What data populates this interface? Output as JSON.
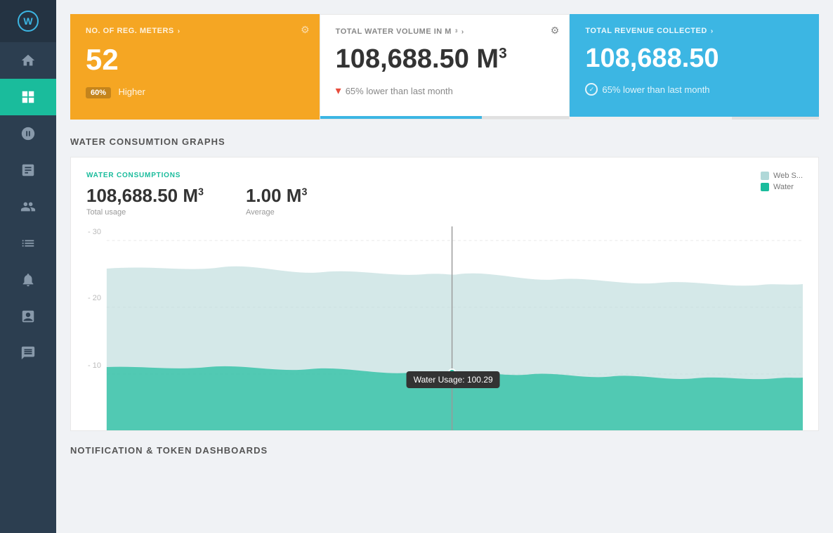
{
  "sidebar": {
    "items": [
      {
        "name": "home",
        "icon": "⌂",
        "active": true
      },
      {
        "name": "users",
        "icon": "👥",
        "active": false
      },
      {
        "name": "charts",
        "icon": "📊",
        "active": false
      },
      {
        "name": "settings",
        "icon": "⚙",
        "active": false
      },
      {
        "name": "groups",
        "icon": "👫",
        "active": false
      },
      {
        "name": "tools",
        "icon": "🔧",
        "active": false
      },
      {
        "name": "notifications",
        "icon": "🔔",
        "active": false
      },
      {
        "name": "calendar",
        "icon": "📅",
        "active": false
      },
      {
        "name": "chat",
        "icon": "💬",
        "active": false
      }
    ]
  },
  "cards": {
    "meters": {
      "title": "NO. OF REG. METERS",
      "value": "52",
      "badge": "60%",
      "badge_label": "Higher",
      "settings_visible": true
    },
    "volume": {
      "title": "TOTAL WATER VOLUME IN M",
      "value": "108,688.50 M",
      "change": "65% lower than last month",
      "settings_visible": true
    },
    "revenue": {
      "title": "TOTAL REVENUE COLLECTED",
      "value": "108,688.50",
      "change": "65% lower than last month",
      "settings_visible": false
    }
  },
  "consumption_section": {
    "title": "WATER CONSUMTION GRAPHS",
    "chart_label": "WATER CONSUMPTIONS",
    "total_usage_value": "108,688.50 M",
    "total_usage_label": "Total usage",
    "average_value": "1.00 M",
    "average_label": "Average",
    "legend": [
      {
        "label": "Web S...",
        "color": "web"
      },
      {
        "label": "Water",
        "color": "water"
      }
    ],
    "y_axis": [
      "30",
      "20",
      "10"
    ],
    "tooltip": "Water Usage: 100.29"
  },
  "notification_section": {
    "title": "NOTIFICATION & TOKEN DASHBOARDS"
  }
}
